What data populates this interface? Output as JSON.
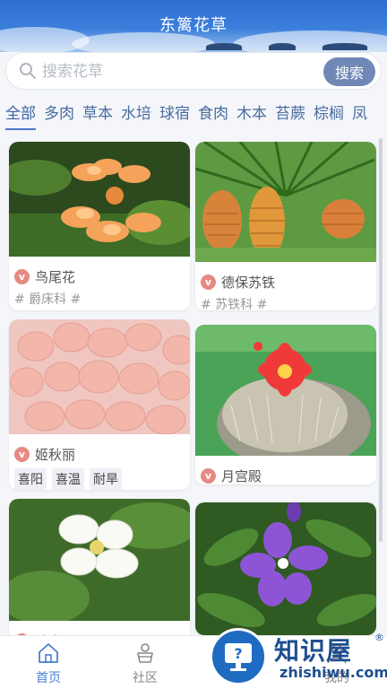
{
  "header": {
    "title": "东篱花草"
  },
  "search": {
    "placeholder": "搜索花草",
    "button_label": "搜索"
  },
  "tabs": [
    {
      "label": "全部",
      "active": true
    },
    {
      "label": "多肉"
    },
    {
      "label": "草本"
    },
    {
      "label": "水培"
    },
    {
      "label": "球宿"
    },
    {
      "label": "食肉"
    },
    {
      "label": "木本"
    },
    {
      "label": "苔蕨"
    },
    {
      "label": "棕榈"
    },
    {
      "label": "凤"
    }
  ],
  "cards": [
    {
      "name": "鸟尾花",
      "family": "# 爵床科 #",
      "badge": "v"
    },
    {
      "name": "德保苏铁",
      "family": "# 苏铁科 #",
      "badge": "v"
    },
    {
      "name": "姬秋丽",
      "tags": [
        "喜阳",
        "喜温",
        "耐旱"
      ],
      "badge": "v"
    },
    {
      "name": "月宫殿",
      "badge": "v"
    },
    {
      "name": "鸡庭",
      "badge": "v"
    }
  ],
  "bottom_nav": [
    {
      "label": "首页",
      "icon": "home-icon",
      "active": true
    },
    {
      "label": "社区",
      "icon": "plant-pot-icon"
    },
    {
      "label": "我的",
      "icon": "profile-icon"
    }
  ],
  "watermark": {
    "text": "知识屋",
    "sub": "zhishiwu.com",
    "reg": "®"
  },
  "colors": {
    "accent": "#4a78c8",
    "search_button": "#6f88b6",
    "badge": "#e58a82"
  }
}
